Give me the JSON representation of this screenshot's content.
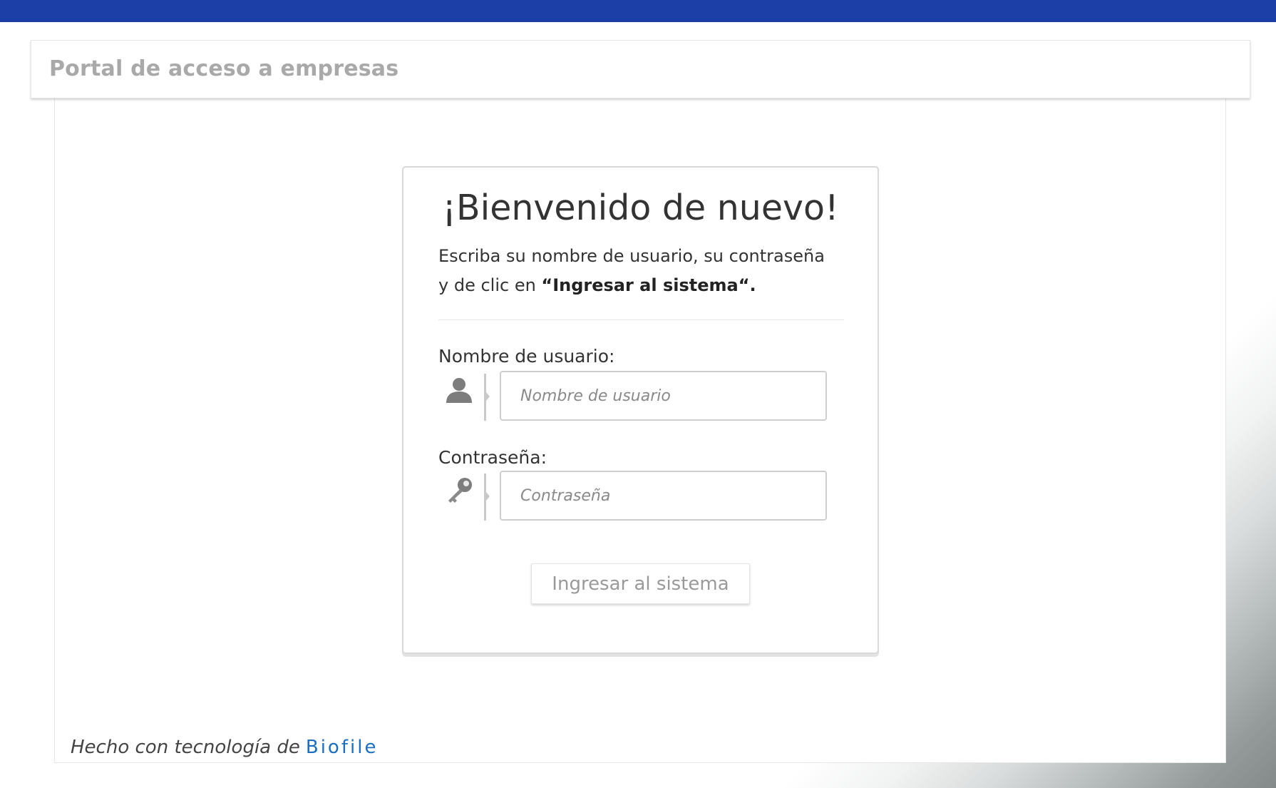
{
  "colors": {
    "top_bar": "#1b3fa6",
    "link": "#1b6fc0"
  },
  "header": {
    "title": "Portal de acceso a empresas"
  },
  "login": {
    "title": "¡Bienvenido de nuevo!",
    "instructions": {
      "line1": "Escriba su nombre de usuario, su contraseña",
      "line2_prefix": "y de clic en ",
      "line2_emphasis": "“Ingresar al sistema“",
      "line2_suffix": "."
    },
    "username": {
      "label": "Nombre de usuario:",
      "placeholder": "Nombre de usuario",
      "value": "",
      "icon": "user-icon"
    },
    "password": {
      "label": "Contraseña:",
      "placeholder": "Contraseña",
      "value": "",
      "icon": "key-icon"
    },
    "submit_label": "Ingresar al sistema"
  },
  "footer": {
    "text": "Hecho con tecnología de",
    "link_text": "Biofile"
  }
}
